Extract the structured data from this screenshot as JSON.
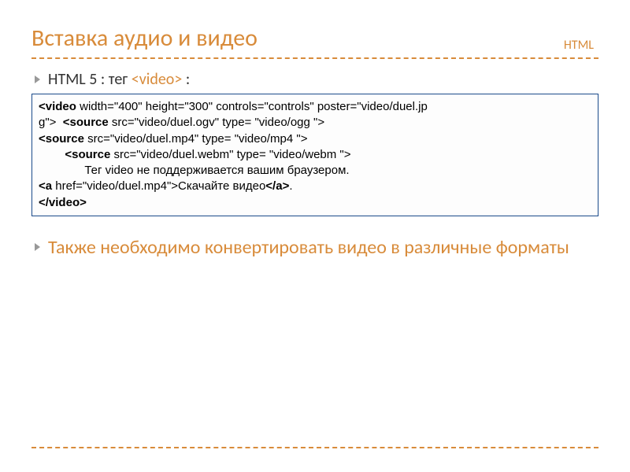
{
  "header": {
    "title": "Вставка аудио и видео",
    "corner": "HTML"
  },
  "bullet1": {
    "prefix": "HTML 5 : тег  ",
    "tag": "<video>",
    "suffix": " :"
  },
  "code": {
    "l1a": "<video",
    "l1b": " width=\"400\" height=\"300\" controls=\"controls\" poster=\"video/duel.jp",
    "l2a": "g\">  ",
    "l2b": "<source",
    "l2c": " src=\"video/duel.ogv\" type= \"video/ogg \">",
    "l3a": "<source",
    "l3b": " src=\"video/duel.mp4\" type= \"video/mp4 \">",
    "l4a": "        <source",
    "l4b": " src=\"video/duel.webm\" type= \"video/webm \">",
    "l5": "              Тег video не поддерживается вашим браузером.",
    "l6a": "<a",
    "l6b": " href=\"video/duel.mp4\">Скачайте видео",
    "l6c": "</a>",
    "l6d": ".",
    "l7": "</video>"
  },
  "bullet2": "Также необходимо конвертировать видео в различные форматы"
}
